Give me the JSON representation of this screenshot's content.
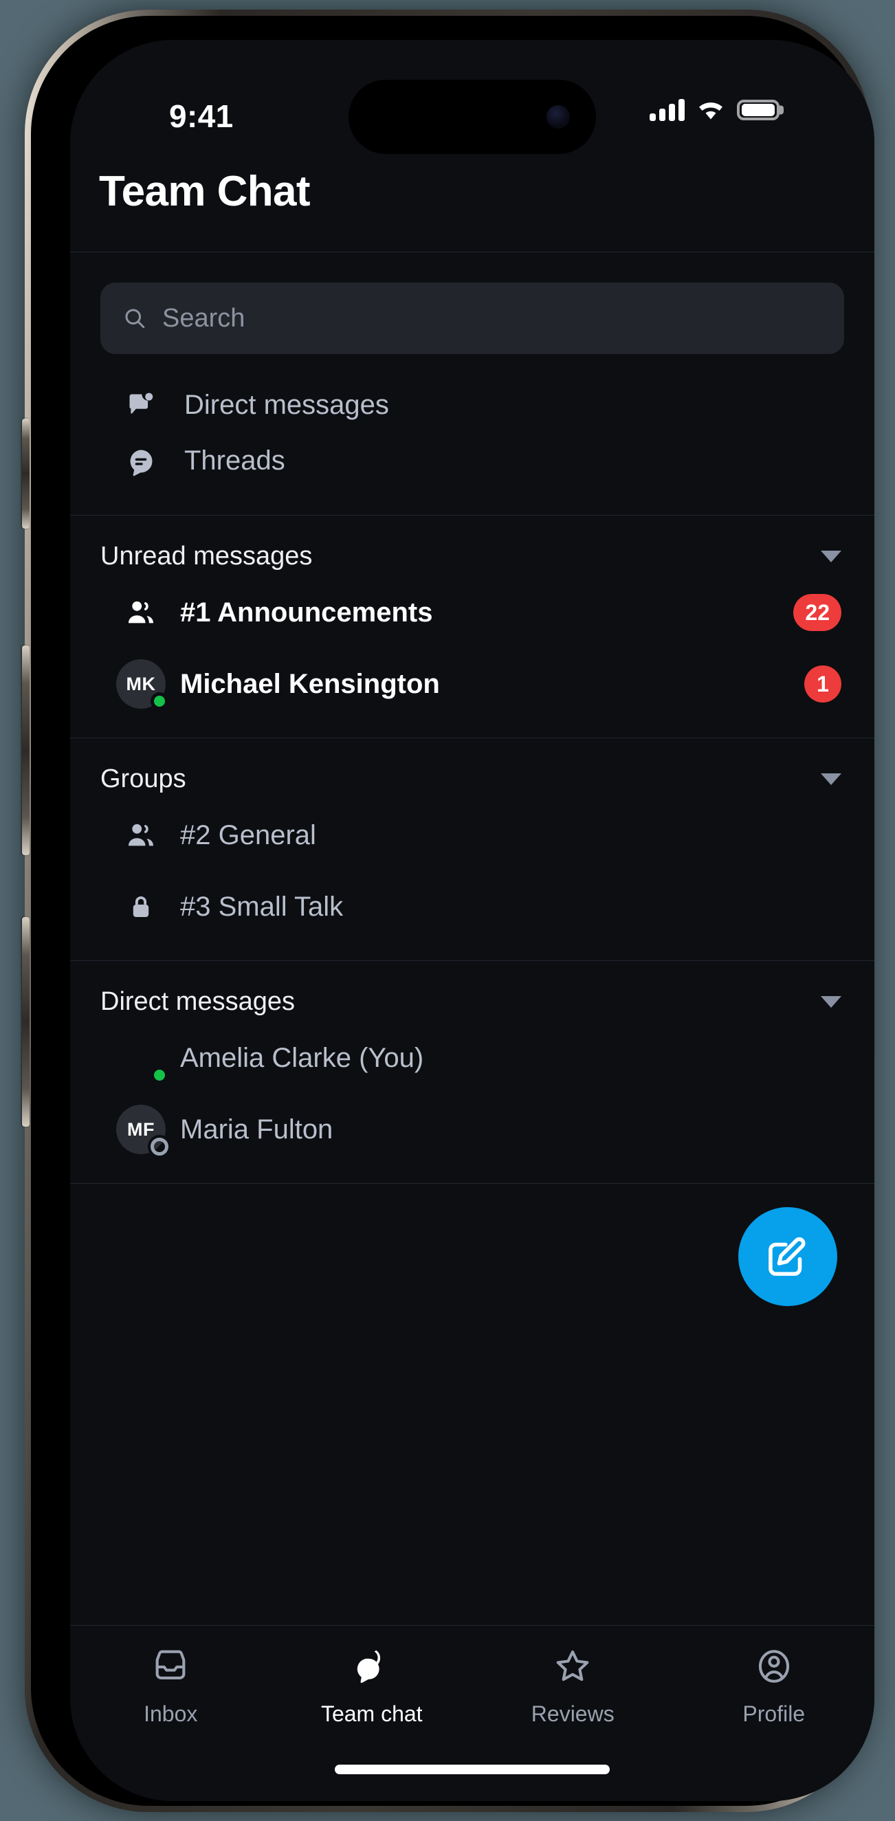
{
  "status_bar": {
    "time": "9:41",
    "cellular_icon": "cellular-signal-icon",
    "wifi_icon": "wifi-icon",
    "battery_icon": "battery-full-icon"
  },
  "header": {
    "title": "Team Chat"
  },
  "search": {
    "placeholder": "Search",
    "value": "",
    "icon": "search-icon"
  },
  "top_nav": [
    {
      "label": "Direct messages",
      "icon": "chat-bubble-dot-icon"
    },
    {
      "label": "Threads",
      "icon": "thread-bubble-icon"
    }
  ],
  "sections": [
    {
      "title": "Unread messages",
      "caret": "chevron-down-icon",
      "items": [
        {
          "label": "#1 Announcements",
          "icon": "people-icon",
          "badge": "22",
          "unread": true
        },
        {
          "label": "Michael Kensington",
          "avatar_initials": "MK",
          "presence": "online",
          "badge": "1",
          "unread": true
        }
      ]
    },
    {
      "title": "Groups",
      "caret": "chevron-down-icon",
      "items": [
        {
          "label": "#2 General",
          "icon": "people-icon",
          "badge": "",
          "unread": false
        },
        {
          "label": "#3 Small Talk",
          "icon": "lock-icon",
          "badge": "",
          "unread": false
        }
      ]
    },
    {
      "title": "Direct messages",
      "caret": "chevron-down-icon",
      "items": [
        {
          "label": "Amelia Clarke (You)",
          "avatar_photo": true,
          "presence": "online",
          "badge": "",
          "unread": false
        },
        {
          "label": "Maria Fulton",
          "avatar_initials": "MF",
          "presence": "offline",
          "badge": "",
          "unread": false
        }
      ]
    }
  ],
  "fab": {
    "icon": "compose-icon",
    "color": "#06a0eb"
  },
  "tabs": [
    {
      "label": "Inbox",
      "icon": "inbox-icon",
      "active": false
    },
    {
      "label": "Team chat",
      "icon": "team-chat-icon",
      "active": true
    },
    {
      "label": "Reviews",
      "icon": "star-icon",
      "active": false
    },
    {
      "label": "Profile",
      "icon": "profile-icon",
      "active": false
    }
  ],
  "colors": {
    "background": "#0c0e12",
    "accent": "#06a0eb",
    "badge": "#ee3b3b",
    "online": "#14c24a",
    "muted_text": "#b9bfcc"
  }
}
